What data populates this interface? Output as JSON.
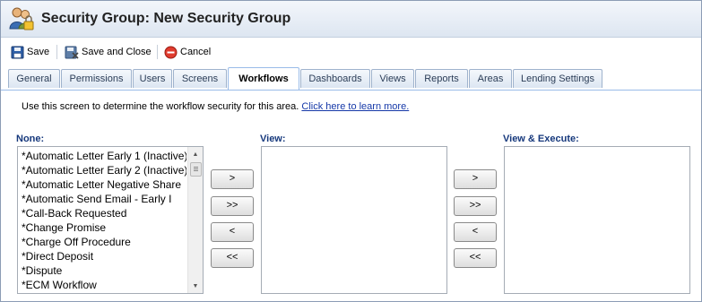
{
  "window": {
    "title": "Security Group: New Security Group",
    "icon": "users-lock-icon"
  },
  "toolbar": {
    "save_label": "Save",
    "save_close_label": "Save and Close",
    "cancel_label": "Cancel"
  },
  "tabs": [
    {
      "label": "General",
      "active": false
    },
    {
      "label": "Permissions",
      "active": false
    },
    {
      "label": "Users",
      "active": false
    },
    {
      "label": "Screens",
      "active": false
    },
    {
      "label": "Workflows",
      "active": true
    },
    {
      "label": "Dashboards",
      "active": false
    },
    {
      "label": "Views",
      "active": false
    },
    {
      "label": "Reports",
      "active": false
    },
    {
      "label": "Areas",
      "active": false
    },
    {
      "label": "Lending Settings",
      "active": false
    }
  ],
  "info": {
    "text": "Use this screen to determine the workflow security for this area.",
    "link": "Click here to learn more."
  },
  "columns": {
    "none_label": "None:",
    "view_label": "View:",
    "view_execute_label": "View & Execute:"
  },
  "none_items": [
    "*Automatic Letter Early 1 (Inactive)",
    "*Automatic Letter Early 2 (Inactive)",
    "*Automatic Letter Negative Share",
    "*Automatic Send Email - Early I",
    "*Call-Back Requested",
    "*Change Promise",
    "*Charge Off Procedure",
    "*Direct Deposit",
    "*Dispute",
    "*ECM Workflow"
  ],
  "move_buttons": {
    "add": ">",
    "add_all": ">>",
    "remove": "<",
    "remove_all": "<<"
  },
  "colors": {
    "accent": "#16387c",
    "tab_border": "#99bbe8",
    "link": "#1538a8"
  }
}
